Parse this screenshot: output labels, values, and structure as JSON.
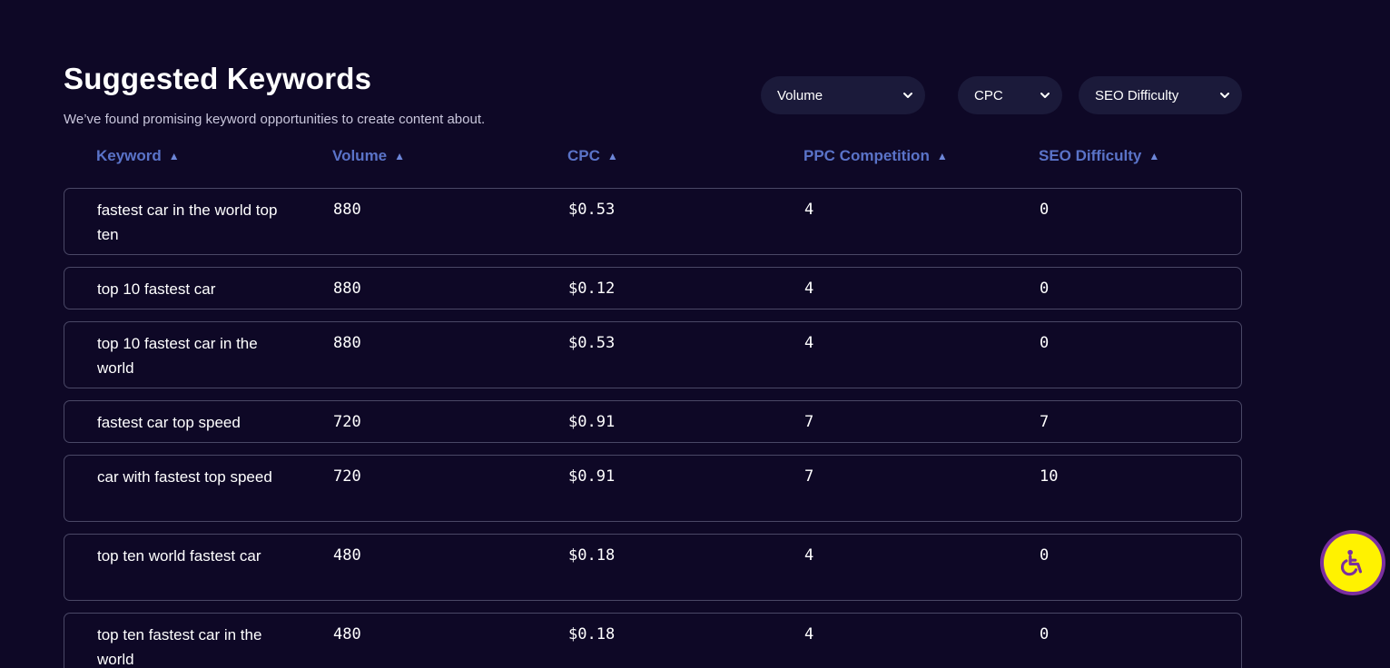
{
  "header": {
    "title": "Suggested Keywords",
    "subtitle": "We’ve found promising keyword opportunities to create content about."
  },
  "filters": [
    {
      "label": "Volume",
      "icon": "chevron-down-icon"
    },
    {
      "label": "CPC",
      "icon": "chevron-down-icon"
    },
    {
      "label": "SEO Difficulty",
      "icon": "chevron-down-icon"
    }
  ],
  "table": {
    "columns": [
      {
        "label": "Keyword",
        "sort_icon": "▲"
      },
      {
        "label": "Volume",
        "sort_icon": "▲"
      },
      {
        "label": "CPC",
        "sort_icon": "▲"
      },
      {
        "label": "PPC Competition",
        "sort_icon": "▲"
      },
      {
        "label": "SEO Difficulty",
        "sort_icon": "▲"
      }
    ],
    "rows": [
      {
        "keyword": "fastest car in the world top ten",
        "volume": "880",
        "cpc": "$0.53",
        "ppc": "4",
        "seo": "0"
      },
      {
        "keyword": "top 10 fastest car",
        "volume": "880",
        "cpc": "$0.12",
        "ppc": "4",
        "seo": "0"
      },
      {
        "keyword": "top 10 fastest car in the world",
        "volume": "880",
        "cpc": "$0.53",
        "ppc": "4",
        "seo": "0"
      },
      {
        "keyword": "fastest car top speed",
        "volume": "720",
        "cpc": "$0.91",
        "ppc": "7",
        "seo": "7"
      },
      {
        "keyword": "car with fastest top speed",
        "volume": "720",
        "cpc": "$0.91",
        "ppc": "7",
        "seo": "10"
      },
      {
        "keyword": "top ten world fastest car",
        "volume": "480",
        "cpc": "$0.18",
        "ppc": "4",
        "seo": "0"
      },
      {
        "keyword": "top ten fastest car in the world",
        "volume": "480",
        "cpc": "$0.18",
        "ppc": "4",
        "seo": "0"
      }
    ]
  },
  "accessibility": {
    "icon": "wheelchair-icon"
  },
  "colors": {
    "background": "#0e0826",
    "header_text": "#5a73c8",
    "filter_bg": "#1b1a3a",
    "row_border": "#4a4866",
    "access_yellow": "#fff200",
    "access_purple": "#7b2fa0"
  }
}
